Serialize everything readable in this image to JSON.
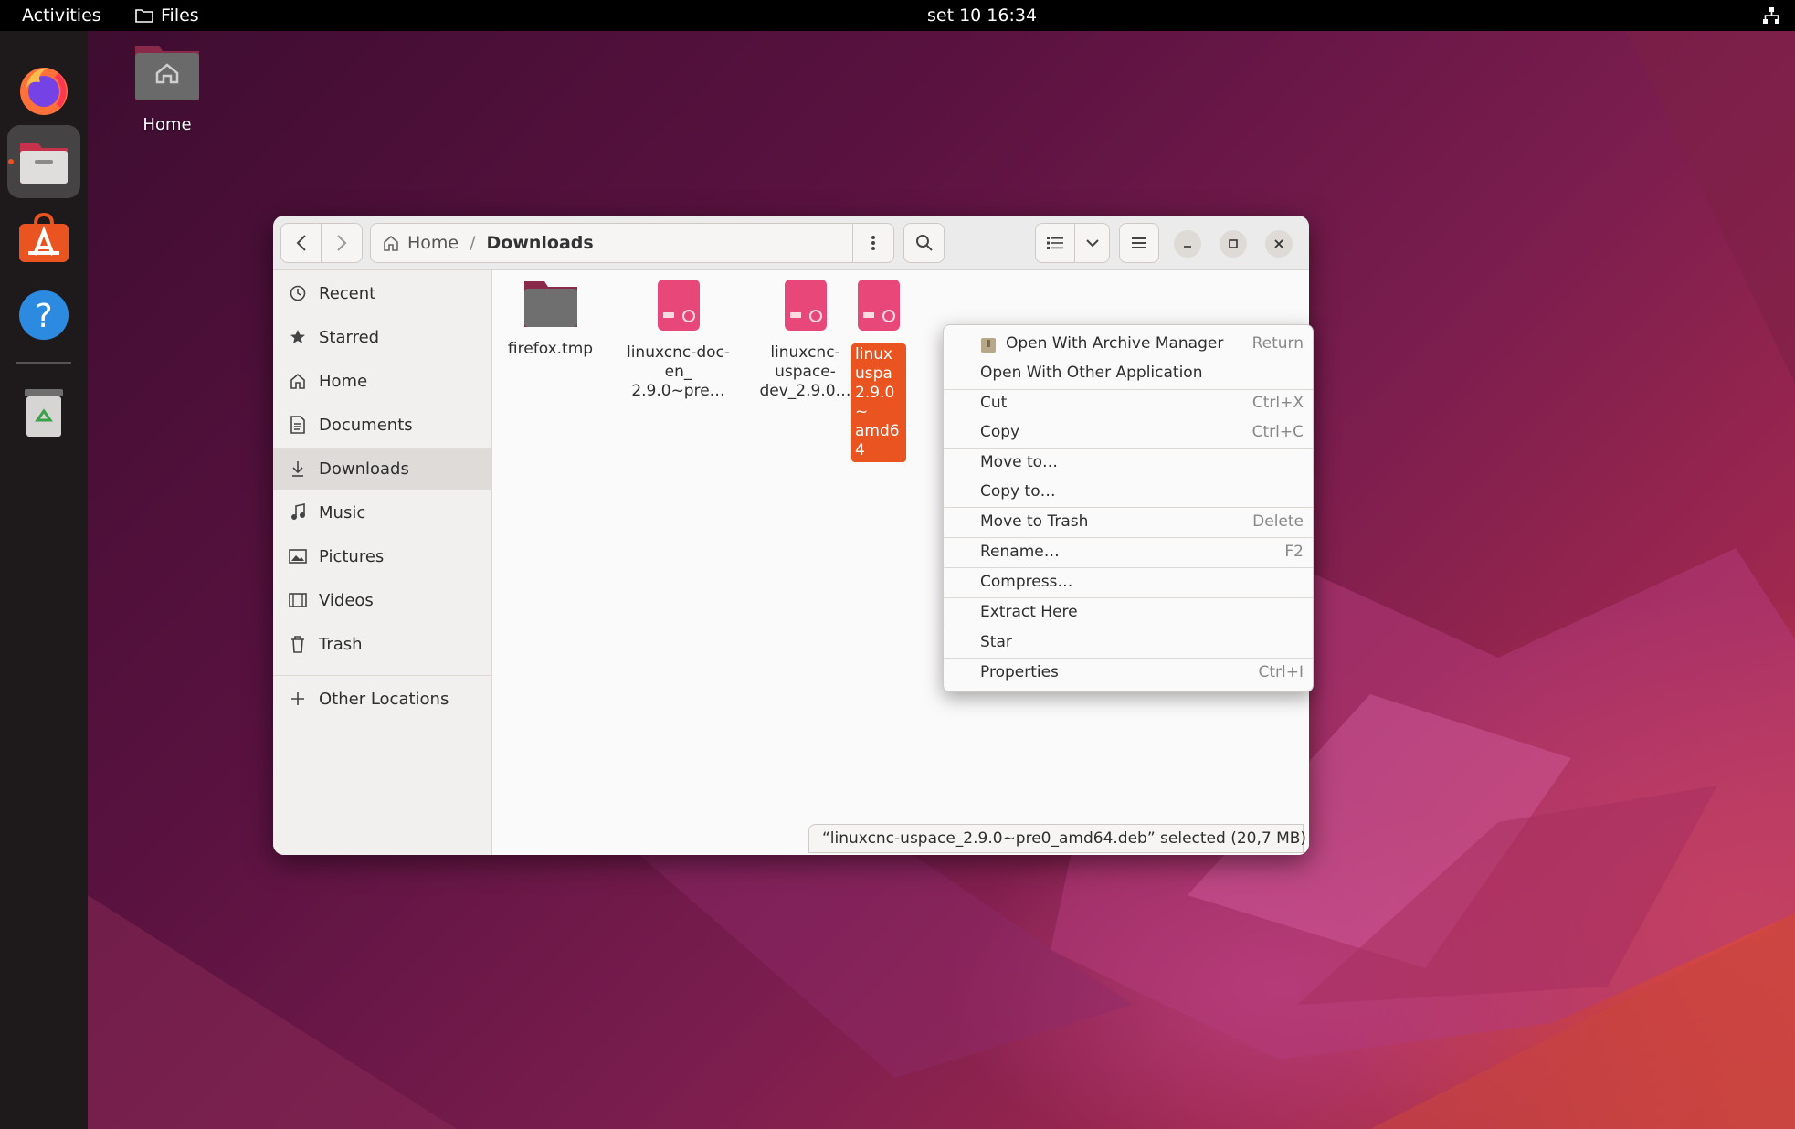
{
  "topbar": {
    "activities": "Activities",
    "app_name": "Files",
    "clock": "set 10  16:34"
  },
  "desktop": {
    "home_label": "Home"
  },
  "dock": {
    "items": [
      "firefox-icon",
      "files-icon",
      "app-center-icon",
      "help-icon",
      "trash-icon"
    ]
  },
  "headerbar": {
    "path_home": "Home",
    "path_separator": "/",
    "path_current": "Downloads"
  },
  "sidebar": {
    "items": [
      {
        "label": "Recent"
      },
      {
        "label": "Starred"
      },
      {
        "label": "Home"
      },
      {
        "label": "Documents"
      },
      {
        "label": "Downloads"
      },
      {
        "label": "Music"
      },
      {
        "label": "Pictures"
      },
      {
        "label": "Videos"
      },
      {
        "label": "Trash"
      }
    ],
    "other_locations": "Other Locations"
  },
  "files": [
    {
      "name": "firefox.tmp"
    },
    {
      "name": "linuxcnc-doc-en_ 2.9.0~pre…"
    },
    {
      "name": "linuxcnc-uspace-dev_2.9.0…"
    },
    {
      "name": "linux uspa 2.9.0~ amd64"
    }
  ],
  "status": "“linuxcnc-uspace_2.9.0~pre0_amd64.deb” selected  (20,7 MB)",
  "context_menu": {
    "items": [
      {
        "label": "Open With Archive Manager",
        "shortcut": "Return"
      },
      {
        "label": "Open With Other Application",
        "shortcut": ""
      },
      {
        "label": "Cut",
        "shortcut": "Ctrl+X"
      },
      {
        "label": "Copy",
        "shortcut": "Ctrl+C"
      },
      {
        "label": "Move to…",
        "shortcut": ""
      },
      {
        "label": "Copy to…",
        "shortcut": ""
      },
      {
        "label": "Move to Trash",
        "shortcut": "Delete"
      },
      {
        "label": "Rename…",
        "shortcut": "F2"
      },
      {
        "label": "Compress…",
        "shortcut": ""
      },
      {
        "label": "Extract Here",
        "shortcut": ""
      },
      {
        "label": "Star",
        "shortcut": ""
      },
      {
        "label": "Properties",
        "shortcut": "Ctrl+I"
      }
    ]
  },
  "colors": {
    "accent": "#e95420",
    "deb_pink": "#e8477a",
    "folder_dark": "#6f6f6f"
  }
}
